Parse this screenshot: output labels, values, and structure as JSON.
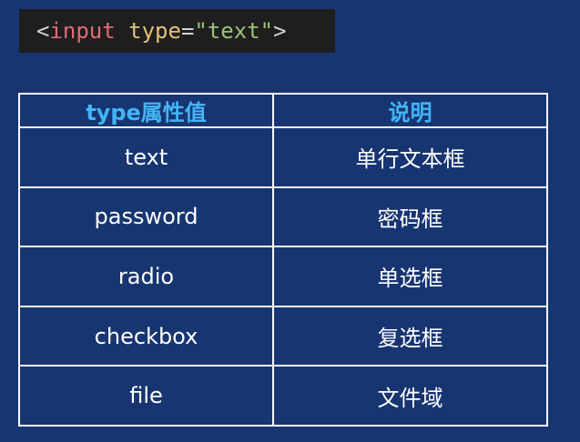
{
  "code": {
    "open": "<",
    "tag": "input",
    "space": " ",
    "attr": "type",
    "equals": "=",
    "value": "\"text\"",
    "close": ">"
  },
  "table": {
    "headers": [
      "type属性值",
      "说明"
    ],
    "rows": [
      [
        "text",
        "单行文本框"
      ],
      [
        "password",
        "密码框"
      ],
      [
        "radio",
        "单选框"
      ],
      [
        "checkbox",
        "复选框"
      ],
      [
        "file",
        "文件域"
      ]
    ]
  },
  "colors": {
    "background": "#173571",
    "header_text": "#43b4f5",
    "cell_text": "#ffffff",
    "border": "#ffffff",
    "code_background": "#1e1e1e"
  }
}
